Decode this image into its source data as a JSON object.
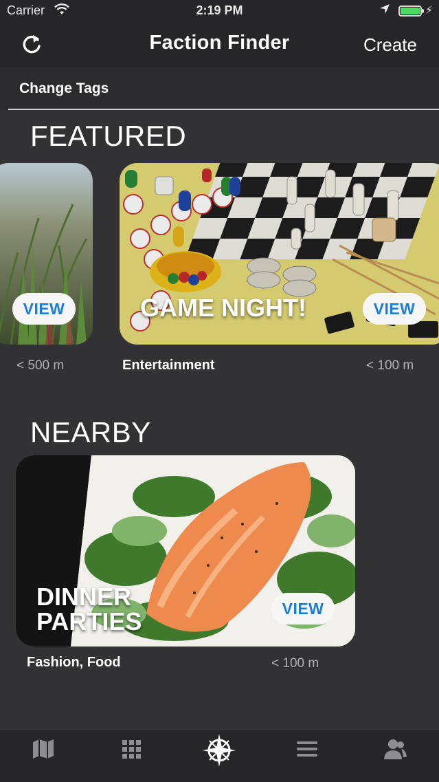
{
  "status_bar": {
    "carrier": "Carrier",
    "time": "2:19 PM"
  },
  "nav": {
    "title": "Faction Finder",
    "create_label": "Create"
  },
  "tags": {
    "label": "Change Tags"
  },
  "featured": {
    "title": "FEATURED",
    "cards": [
      {
        "title": "",
        "view_label": "VIEW",
        "distance": "< 500 m",
        "image": "grass-plants"
      },
      {
        "title": "GAME NIGHT!",
        "view_label": "VIEW",
        "category": "Entertainment",
        "distance": "< 100 m",
        "image": "board-games"
      }
    ]
  },
  "nearby": {
    "title": "NEARBY",
    "cards": [
      {
        "title_line1": "DINNER",
        "title_line2": "PARTIES",
        "view_label": "VIEW",
        "category": "Fashion, Food",
        "distance": "< 100 m",
        "image": "salmon-dish"
      }
    ]
  },
  "tab_bar": {
    "items": [
      {
        "icon": "map-icon"
      },
      {
        "icon": "grid-icon"
      },
      {
        "icon": "compass-icon",
        "active": true
      },
      {
        "icon": "list-icon"
      },
      {
        "icon": "people-icon"
      }
    ]
  },
  "colors": {
    "background": "#323234",
    "bar": "#262628",
    "view_text": "#1a7fd4",
    "battery": "#4cd964"
  }
}
